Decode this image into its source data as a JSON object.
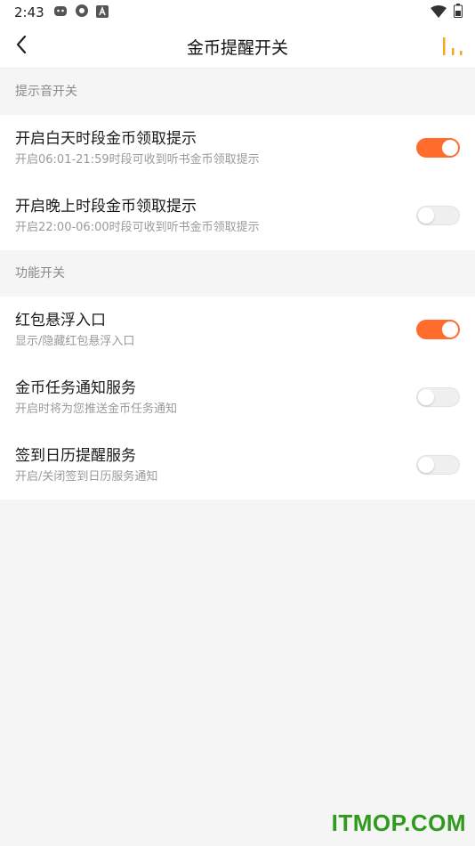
{
  "status_bar": {
    "time": "2:43",
    "left_icons": [
      "android-icon",
      "settings-icon",
      "a-icon"
    ],
    "right_icons": [
      "wifi-icon",
      "battery-icon"
    ]
  },
  "header": {
    "title": "金币提醒开关",
    "back_icon": "chevron-left-icon",
    "menu_icon": "bar-chart-icon"
  },
  "colors": {
    "accent": "#ff6c2c",
    "menu_icon": "#f5a623",
    "watermark": "#2f9a1e"
  },
  "sections": [
    {
      "title": "提示音开关",
      "items": [
        {
          "label": "开启白天时段金币领取提示",
          "desc": "开启06:01-21:59时段可收到听书金币领取提示",
          "on": true
        },
        {
          "label": "开启晚上时段金币领取提示",
          "desc": "开启22:00-06:00时段可收到听书金币领取提示",
          "on": false
        }
      ]
    },
    {
      "title": "功能开关",
      "items": [
        {
          "label": "红包悬浮入口",
          "desc": "显示/隐藏红包悬浮入口",
          "on": true
        },
        {
          "label": "金币任务通知服务",
          "desc": "开启时将为您推送金币任务通知",
          "on": false
        },
        {
          "label": "签到日历提醒服务",
          "desc": "开启/关闭签到日历服务通知",
          "on": false
        }
      ]
    }
  ],
  "watermark": "ITMOP.COM"
}
